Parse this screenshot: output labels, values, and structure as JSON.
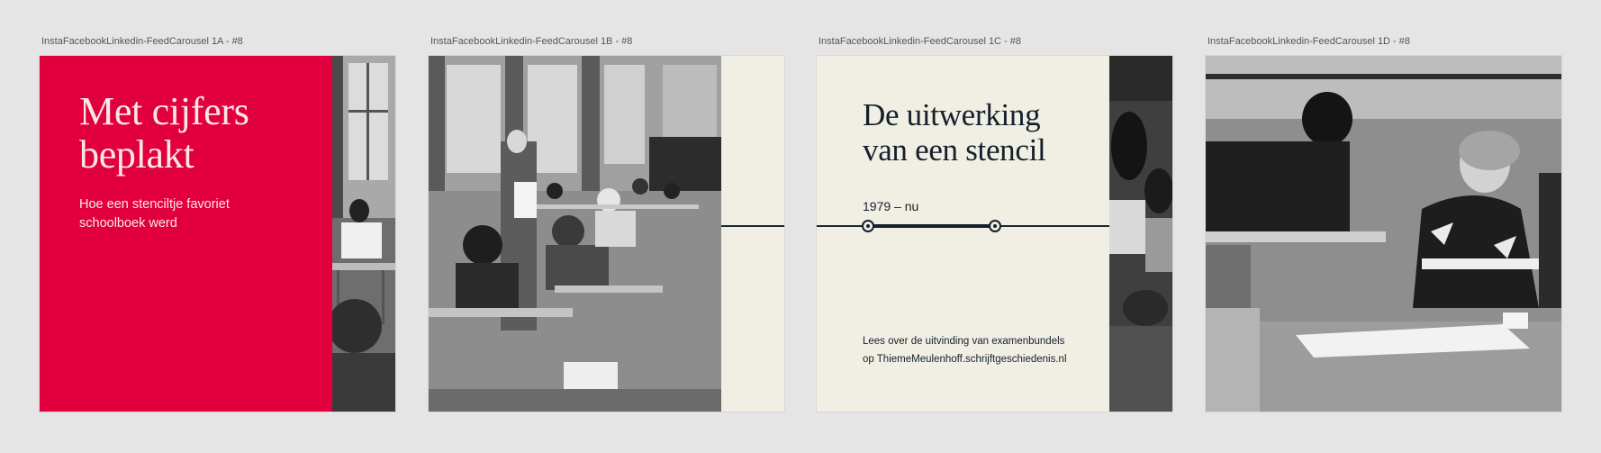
{
  "frames": [
    {
      "label": "InstaFacebookLinkedin-FeedCarousel 1A - #8",
      "title_line1": "Met cijfers",
      "title_line2": "beplakt",
      "subtitle_line1": "Hoe een stenciltje favoriet",
      "subtitle_line2": "schoolboek werd",
      "background": "#e1003d"
    },
    {
      "label": "InstaFacebookLinkedin-FeedCarousel 1B - #8",
      "background": "#f1eee4"
    },
    {
      "label": "InstaFacebookLinkedin-FeedCarousel 1C - #8",
      "title_line1": "De uitwerking",
      "title_line2": "van een stencil",
      "range": "1979 – nu",
      "footer_line1": "Lees over de uitvinding van examenbundels",
      "footer_line2": "op ThiemeMeulenhoff.schrijftgeschiedenis.nl",
      "background": "#f1eee4"
    },
    {
      "label": "InstaFacebookLinkedin-FeedCarousel 1D - #8"
    }
  ],
  "colors": {
    "canvas": "#e5e5e5",
    "accent_red": "#e1003d",
    "cream": "#f1eee4",
    "ink": "#14202b"
  }
}
